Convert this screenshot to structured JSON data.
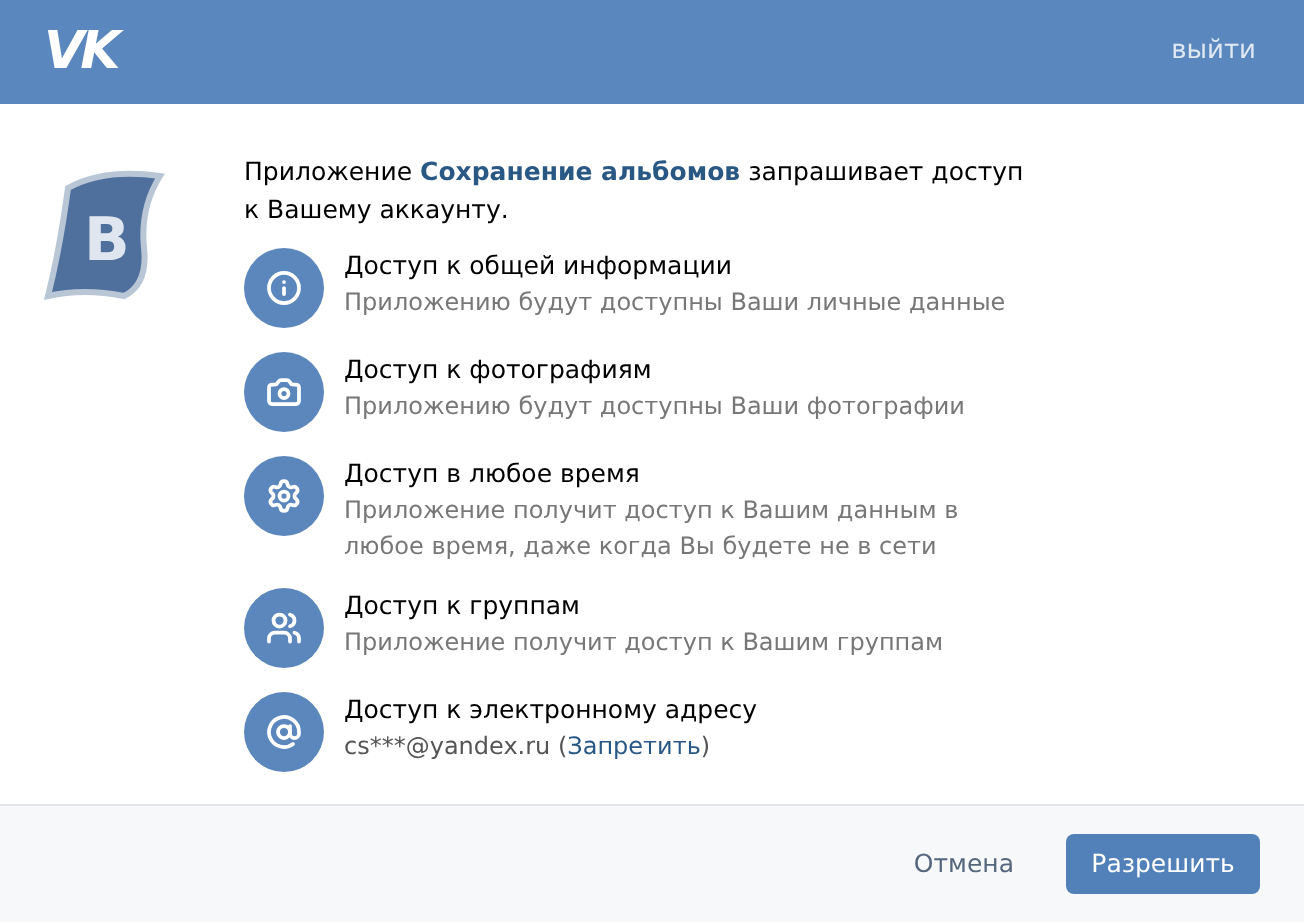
{
  "header": {
    "logo": "VK",
    "logout": "выйти"
  },
  "app_icon": {
    "letter": "B"
  },
  "intro": "Приложение **Сохранение альбомов** запрашивает доступ к Вашему аккаунту.",
  "permissions": [
    {
      "kind": "info",
      "title": "Доступ к общей информации",
      "description": "Приложению будут доступны Ваши личные данные"
    },
    {
      "kind": "camera",
      "title": "Доступ к фотографиям",
      "description": "Приложению будут доступны Ваши фотографии"
    },
    {
      "kind": "gear",
      "title": "Доступ в любое время",
      "description": "Приложение получит доступ к Вашим данным в любое время, даже когда Вы будете не в сети"
    },
    {
      "kind": "group",
      "title": "Доступ к группам",
      "description": "Приложение получит доступ к Вашим группам"
    },
    {
      "kind": "at",
      "title": "Доступ к электронному адресу",
      "description": "cs***@yandex.ru (",
      "link": "Запретить",
      "description_end": ")"
    }
  ],
  "footer": {
    "cancel": "Отмена",
    "allow": "Разрешить"
  }
}
